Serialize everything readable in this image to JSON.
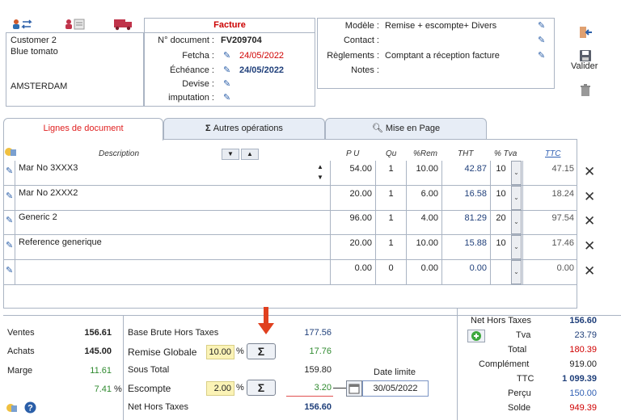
{
  "toolbar": {
    "icons": [
      "users-swap-icon",
      "user-card-icon",
      "truck-icon"
    ],
    "colors": {
      "truck": "#c0334a",
      "users": "#d15a2a"
    }
  },
  "customer": {
    "name": "Customer 2",
    "company": "Blue tomato",
    "city": "AMSTERDAM"
  },
  "invoice": {
    "title": "Facture",
    "doc_label": "N° document :",
    "doc_value": "FV209704",
    "fetcha_label": "Fetcha :",
    "fetcha_value": "24/05/2022",
    "echeance_label": "Échéance :",
    "echeance_value": "24/05/2022",
    "devise_label": "Devise :",
    "imputation_label": "imputation :"
  },
  "meta": {
    "modele_label": "Modèle :",
    "modele_value": "Remise + escompte+ Divers",
    "contact_label": "Contact :",
    "reglements_label": "Règlements :",
    "reglements_value": "Comptant a réception facture",
    "notes_label": "Notes :"
  },
  "actions": {
    "valider_label": "Valider"
  },
  "tabs": [
    {
      "label": "Lignes de document"
    },
    {
      "label": "Autres opérations"
    },
    {
      "label": "Mise en Page"
    }
  ],
  "grid": {
    "headers": {
      "description": "Description",
      "pu": "P U",
      "qu": "Qu",
      "rem": "%Rem",
      "tht": "THT",
      "tva": "% Tva",
      "ttc": "TTC"
    },
    "rows": [
      {
        "desc": "Mar No 3XXX3",
        "pu": "54.00",
        "qu": "1",
        "rem": "10.00",
        "tht": "42.87",
        "tva": "10",
        "ttc": "47.15"
      },
      {
        "desc": "Mar No 2XXX2",
        "pu": "20.00",
        "qu": "1",
        "rem": "6.00",
        "tht": "16.58",
        "tva": "10",
        "ttc": "18.24"
      },
      {
        "desc": "Generic 2",
        "pu": "96.00",
        "qu": "1",
        "rem": "4.00",
        "tht": "81.29",
        "tva": "20",
        "ttc": "97.54"
      },
      {
        "desc": "Reference generique",
        "pu": "20.00",
        "qu": "1",
        "rem": "10.00",
        "tht": "15.88",
        "tva": "10",
        "ttc": "17.46"
      },
      {
        "desc": "",
        "pu": "0.00",
        "qu": "0",
        "rem": "0.00",
        "tht": "0.00",
        "tva": "",
        "ttc": "0.00"
      }
    ]
  },
  "stats": {
    "ventes_label": "Ventes",
    "ventes_value": "156.61",
    "achats_label": "Achats",
    "achats_value": "145.00",
    "marge_label": "Marge",
    "marge_value": "11.61",
    "marge_pct": "7.41",
    "pct_sign": "%"
  },
  "calc": {
    "base_label": "Base Brute Hors Taxes",
    "base_value": "177.56",
    "remise_label": "Remise Globale",
    "remise_pct": "10.00",
    "remise_value": "17.76",
    "sous_total_label": "Sous Total",
    "sous_total_value": "159.80",
    "escompte_label": "Escompte",
    "escompte_pct": "2.00",
    "escompte_value": "3.20",
    "date_limite_label": "Date limite",
    "date_limite_value": "30/05/2022",
    "net_ht_label": "Net Hors Taxes",
    "net_ht_value": "156.60",
    "pct_sign": "%",
    "sigma": "Σ"
  },
  "totals": {
    "net_ht_label": "Net Hors Taxes",
    "net_ht_value": "156.60",
    "tva_label": "Tva",
    "tva_value": "23.79",
    "total_label": "Total",
    "total_value": "180.39",
    "complement_label": "Complément",
    "complement_value": "919.00",
    "ttc_label": "TTC",
    "ttc_value": "1 099.39",
    "percu_label": "Perçu",
    "percu_value": "150.00",
    "solde_label": "Solde",
    "solde_value": "949.39"
  }
}
